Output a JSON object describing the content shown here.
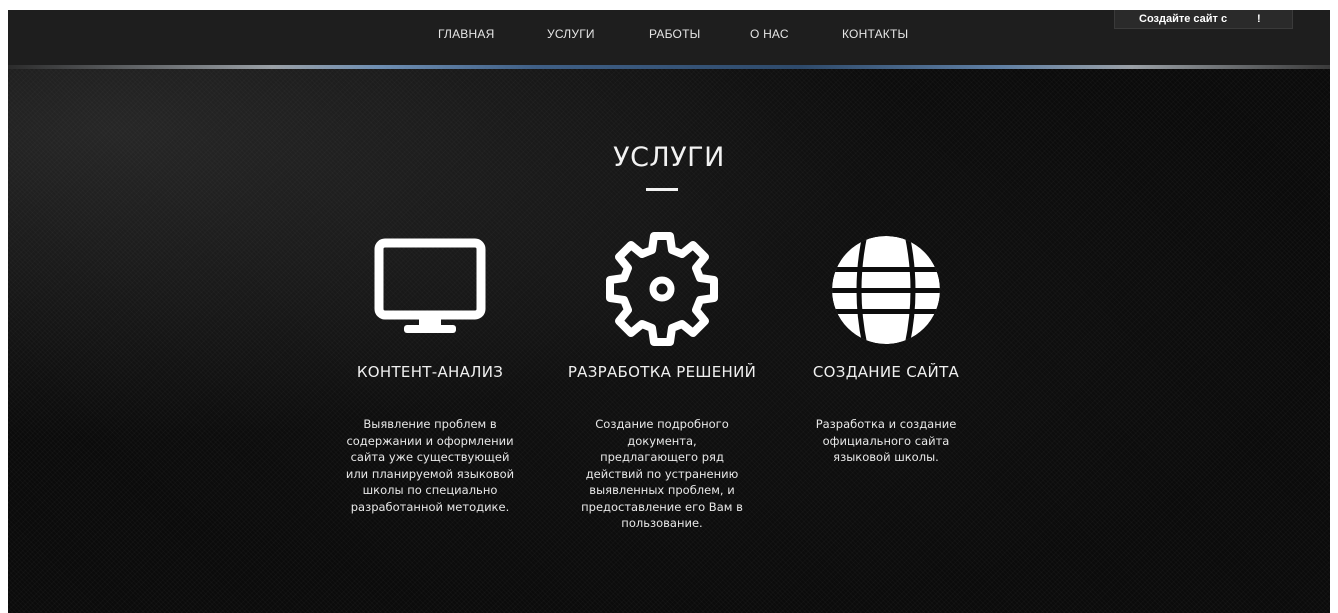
{
  "nav": {
    "items": [
      "ГЛАВНАЯ",
      "УСЛУГИ",
      "РАБОТЫ",
      "О НАС",
      "КОНТАКТЫ"
    ],
    "cta_label": "Создайте сайт с",
    "cta_suffix": "!"
  },
  "section": {
    "title": "УСЛУГИ"
  },
  "services": [
    {
      "icon": "monitor-icon",
      "title": "КОНТЕНТ-АНАЛИЗ",
      "description": "Выявление проблем в содержании и оформлении сайта уже существующей или планируемой языковой школы по специально разработанной методике."
    },
    {
      "icon": "gear-icon",
      "title": "РАЗРАБОТКА РЕШЕНИЙ",
      "description": "Создание подробного документа, предлагающего ряд действий по устранению выявленных проблем, и предоставление его Вам в пользование."
    },
    {
      "icon": "globe-icon",
      "title": "СОЗДАНИЕ САЙТА",
      "description": "Разработка и создание официального сайта языковой школы."
    }
  ],
  "colors": {
    "background": "#0d0d0d",
    "navbar": "#1e1e1e",
    "text": "#f0f0f0",
    "accent": "#ffffff"
  }
}
